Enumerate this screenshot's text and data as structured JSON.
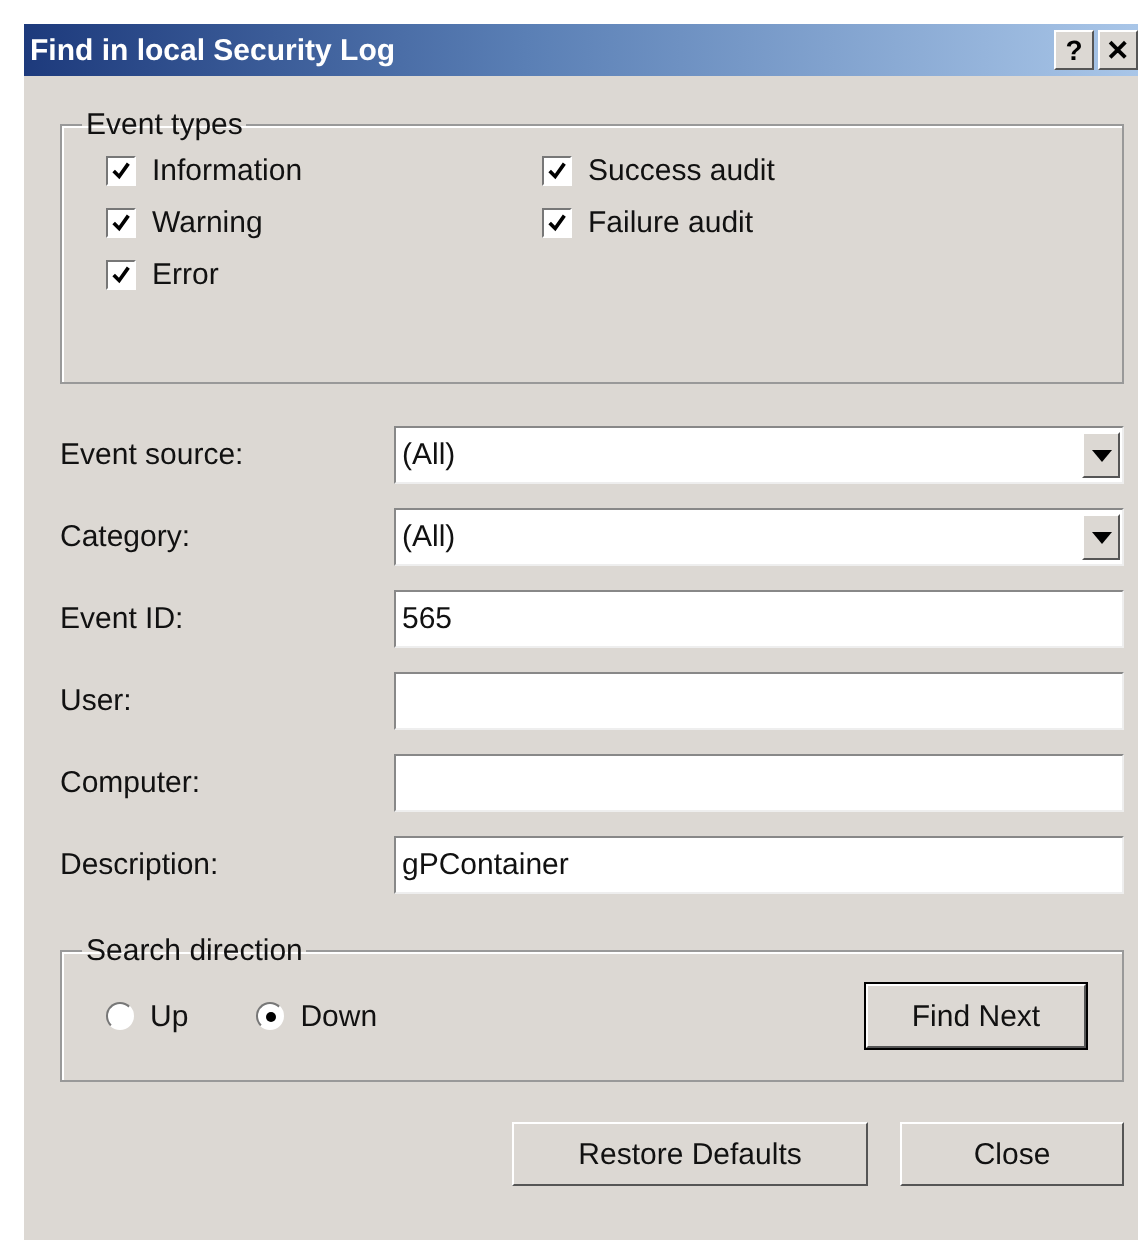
{
  "window": {
    "title": "Find in local Security Log",
    "title_buttons": [
      "?",
      "✕"
    ]
  },
  "event_types": {
    "label": "Event types",
    "items": [
      {
        "label": "Information",
        "checked": true
      },
      {
        "label": "Success audit",
        "checked": true
      },
      {
        "label": "Warning",
        "checked": true
      },
      {
        "label": "Failure audit",
        "checked": true
      },
      {
        "label": "Error",
        "checked": true
      }
    ]
  },
  "fields": [
    {
      "label": "Event source:",
      "kind": "dropdown",
      "value": "(All)"
    },
    {
      "label": "Category:",
      "kind": "dropdown",
      "value": "(All)"
    },
    {
      "label": "Event ID:",
      "kind": "text",
      "value": "565"
    },
    {
      "label": "User:",
      "kind": "text"
    },
    {
      "label": "Computer:",
      "kind": "text"
    },
    {
      "label": "Description:",
      "kind": "text",
      "value": "gPContainer"
    }
  ],
  "search_direction": {
    "label": "Search direction",
    "options": [
      {
        "label": "Up",
        "selected": false
      },
      {
        "label": "Down",
        "selected": true
      }
    ],
    "button": "Find Next"
  },
  "buttons": [
    "Restore Defaults",
    "Close"
  ]
}
